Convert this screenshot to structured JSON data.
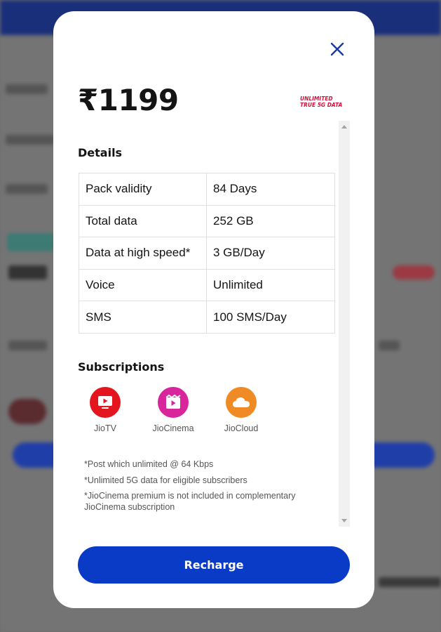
{
  "plan": {
    "price": "₹1199",
    "badge_line1": "UNLIMITED",
    "badge_line2": "TRUE 5G DATA"
  },
  "details": {
    "heading": "Details",
    "rows": [
      {
        "label": "Pack validity",
        "value": "84 Days"
      },
      {
        "label": "Total data",
        "value": "252 GB"
      },
      {
        "label": "Data at high speed*",
        "value": "3 GB/Day"
      },
      {
        "label": "Voice",
        "value": "Unlimited"
      },
      {
        "label": "SMS",
        "value": "100 SMS/Day"
      }
    ]
  },
  "subscriptions": {
    "heading": "Subscriptions",
    "items": [
      {
        "name": "JioTV",
        "icon": "jiotv-icon",
        "color": "#e3161f"
      },
      {
        "name": "JioCinema",
        "icon": "jiocinema-icon",
        "color": "#d9259b"
      },
      {
        "name": "JioCloud",
        "icon": "jiocloud-icon",
        "color": "#f08a24"
      }
    ]
  },
  "notes": [
    "*Post which unlimited @ 64 Kbps",
    "*Unlimited 5G data for eligible subscribers",
    "*JioCinema premium is not included in complementary JioCinema subscription"
  ],
  "actions": {
    "recharge_label": "Recharge"
  },
  "colors": {
    "primary": "#0a3bc7",
    "badge": "#d0123b",
    "close_icon": "#1a3aa0"
  }
}
